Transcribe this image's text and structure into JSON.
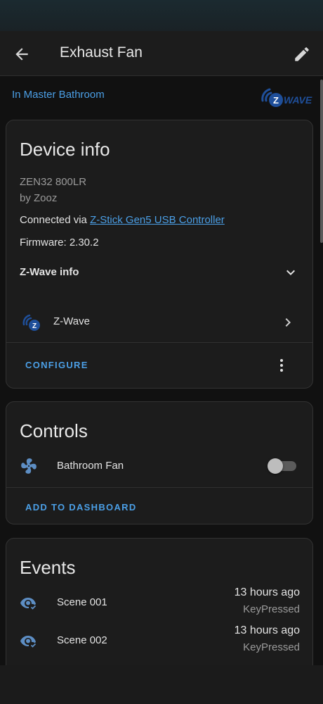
{
  "header": {
    "title": "Exhaust Fan"
  },
  "area": {
    "label": "In Master Bathroom"
  },
  "device_info": {
    "title": "Device info",
    "model": "ZEN32 800LR",
    "manufacturer": "by Zooz",
    "connected_prefix": "Connected via ",
    "connected_link": "Z-Stick Gen5 USB Controller",
    "firmware": "Firmware: 2.30.2",
    "zwave_info_label": "Z-Wave info",
    "integration_label": "Z-Wave",
    "configure_label": "CONFIGURE"
  },
  "controls": {
    "title": "Controls",
    "entity_label": "Bathroom Fan",
    "toggle_state": "off",
    "add_label": "ADD TO DASHBOARD"
  },
  "events": {
    "title": "Events",
    "items": [
      {
        "name": "Scene 001",
        "time": "13 hours ago",
        "detail": "KeyPressed"
      },
      {
        "name": "Scene 002",
        "time": "13 hours ago",
        "detail": "KeyPressed"
      }
    ]
  },
  "colors": {
    "accent": "#4b9fe6",
    "zwave_brand": "#1f4f9a",
    "icon_blue": "#5d8ec4"
  }
}
